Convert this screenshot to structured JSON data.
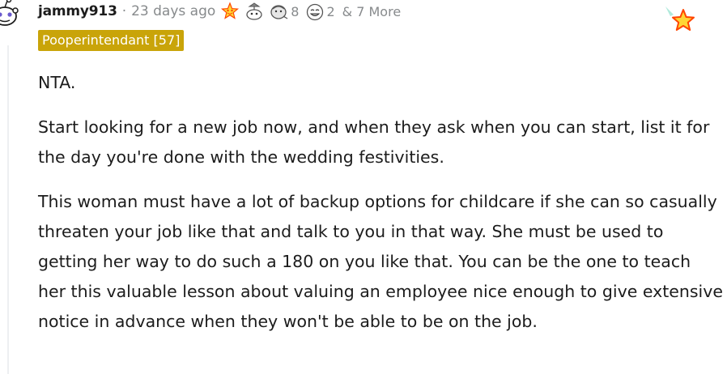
{
  "comment": {
    "author": "jammy913",
    "separator": "·",
    "time": "23 days ago",
    "awards": [
      {
        "icon": "starstruck-icon",
        "count": ""
      },
      {
        "icon": "rocket-like-icon",
        "count": ""
      },
      {
        "icon": "wholesome-seal-icon",
        "count": "8"
      },
      {
        "icon": "laughing-face-icon",
        "count": "2"
      }
    ],
    "more_awards": "& 7 More",
    "flair": "Pooperintendant [57]",
    "paragraphs": [
      "NTA.",
      "Start looking for a new job now, and when they ask when you can start, list it for the day you're done with the wedding festivities.",
      "This woman must have a lot of backup options for childcare if she can so casually threaten your job like that and talk to you in that way. She must be used to getting her way to do such a 180 on you like that. You can be the one to teach her this valuable lesson about valuing an employee nice enough to give extensive notice in advance when they won't be able to be on the job."
    ]
  },
  "colors": {
    "flair_bg": "#c9a409",
    "meta_text": "#878a8c",
    "body_text": "#1c1c1c",
    "star_fill": "#ffd635",
    "star_outline": "#ff4500"
  }
}
